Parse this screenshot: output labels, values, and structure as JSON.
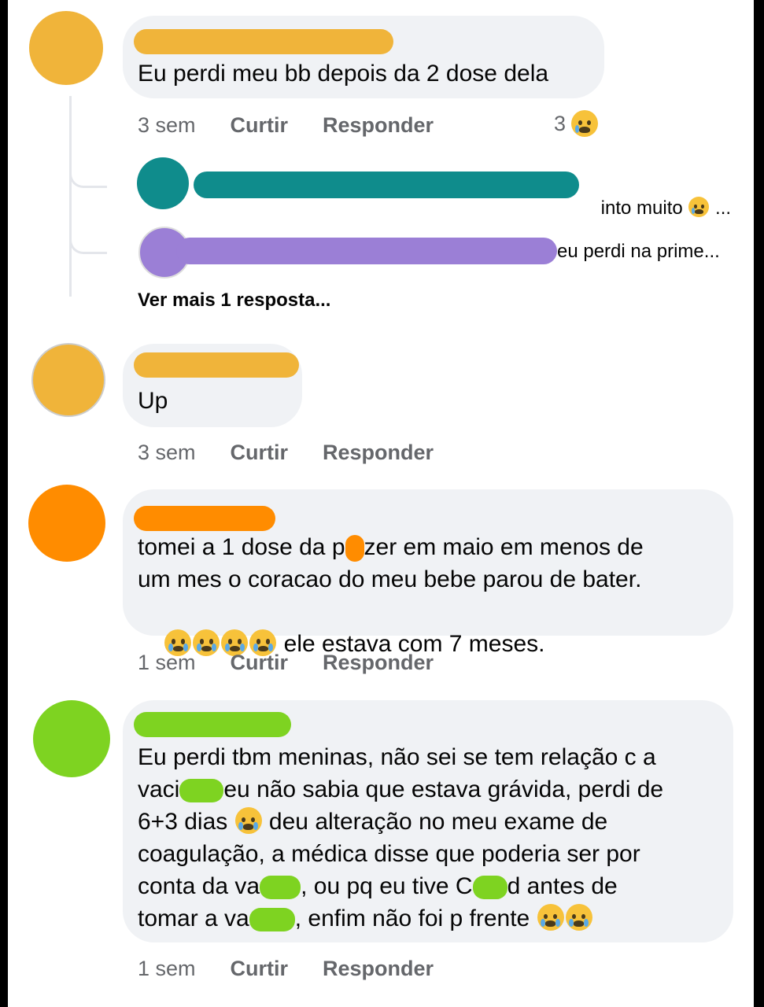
{
  "comments": [
    {
      "text": "Eu perdi meu bb depois da 2 dose dela",
      "time": "3 sem",
      "like": "Curtir",
      "reply": "Responder",
      "reaction_count": "3",
      "avatar_color": "#f0b43a"
    },
    {
      "text": "Up",
      "time": "3 sem",
      "like": "Curtir",
      "reply": "Responder",
      "avatar_color": "#f0b43a"
    },
    {
      "line1a": "tomei a 1 dose da p",
      "line1b": "zer em maio em menos de",
      "line2": "um mes o coracao do meu bebe parou de bater.",
      "line3": " ele estava com 7 meses.",
      "time": "1 sem",
      "like": "Curtir",
      "reply": "Responder",
      "avatar_color": "#ff8c00"
    },
    {
      "line1": "Eu perdi tbm meninas, não sei se tem relação c a",
      "line2a": "vaci",
      "line2b": "eu não sabia que estava grávida, perdi de",
      "line3a": "6+3 dias ",
      "line3b": " deu alteração no meu exame de",
      "line4": "coagulação, a médica disse que poderia ser por",
      "line5a": "conta da va",
      "line5b": ", ou pq eu tive C",
      "line5c": "d antes de",
      "line6a": "tomar a va",
      "line6b": ", enfim não foi p frente ",
      "time": "1 sem",
      "like": "Curtir",
      "reply": "Responder",
      "avatar_color": "#7ed321"
    }
  ],
  "replies": [
    {
      "text": "into muito ",
      "suffix": " ...",
      "color": "#0f8c8c"
    },
    {
      "text": "eu perdi na prime...",
      "color": "#9b7fd6"
    }
  ],
  "see_more": "Ver mais 1 resposta...",
  "colors": {
    "bubble": "#f0f2f5",
    "meta": "#65676b"
  }
}
